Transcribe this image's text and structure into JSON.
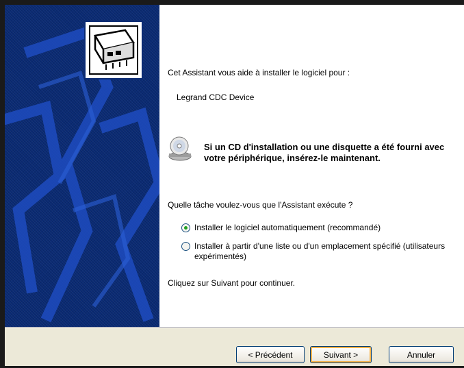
{
  "wizard": {
    "intro": "Cet Assistant vous aide à installer le logiciel pour :",
    "device_name": "Legrand CDC Device",
    "cd_prompt": "Si un CD d'installation ou une disquette a été fourni avec votre périphérique, insérez-le maintenant.",
    "question": "Quelle tâche voulez-vous que l'Assistant exécute ?",
    "options": [
      {
        "label": "Installer le logiciel automatiquement (recommandé)",
        "selected": true
      },
      {
        "label": "Installer à partir d'une liste ou d'un emplacement spécifié (utilisateurs expérimentés)",
        "selected": false
      }
    ],
    "continue_hint": "Cliquez sur Suivant pour continuer."
  },
  "buttons": {
    "back": "< Précédent",
    "next": "Suivant >",
    "cancel": "Annuler"
  },
  "icons": {
    "banner": "hardware-card-icon",
    "cd": "cd-drive-icon"
  },
  "colors": {
    "banner_blue": "#0a2a73",
    "footer_bg": "#ece9d8",
    "radio_dot": "#21a121",
    "default_button_highlight": "#f8b44a"
  }
}
